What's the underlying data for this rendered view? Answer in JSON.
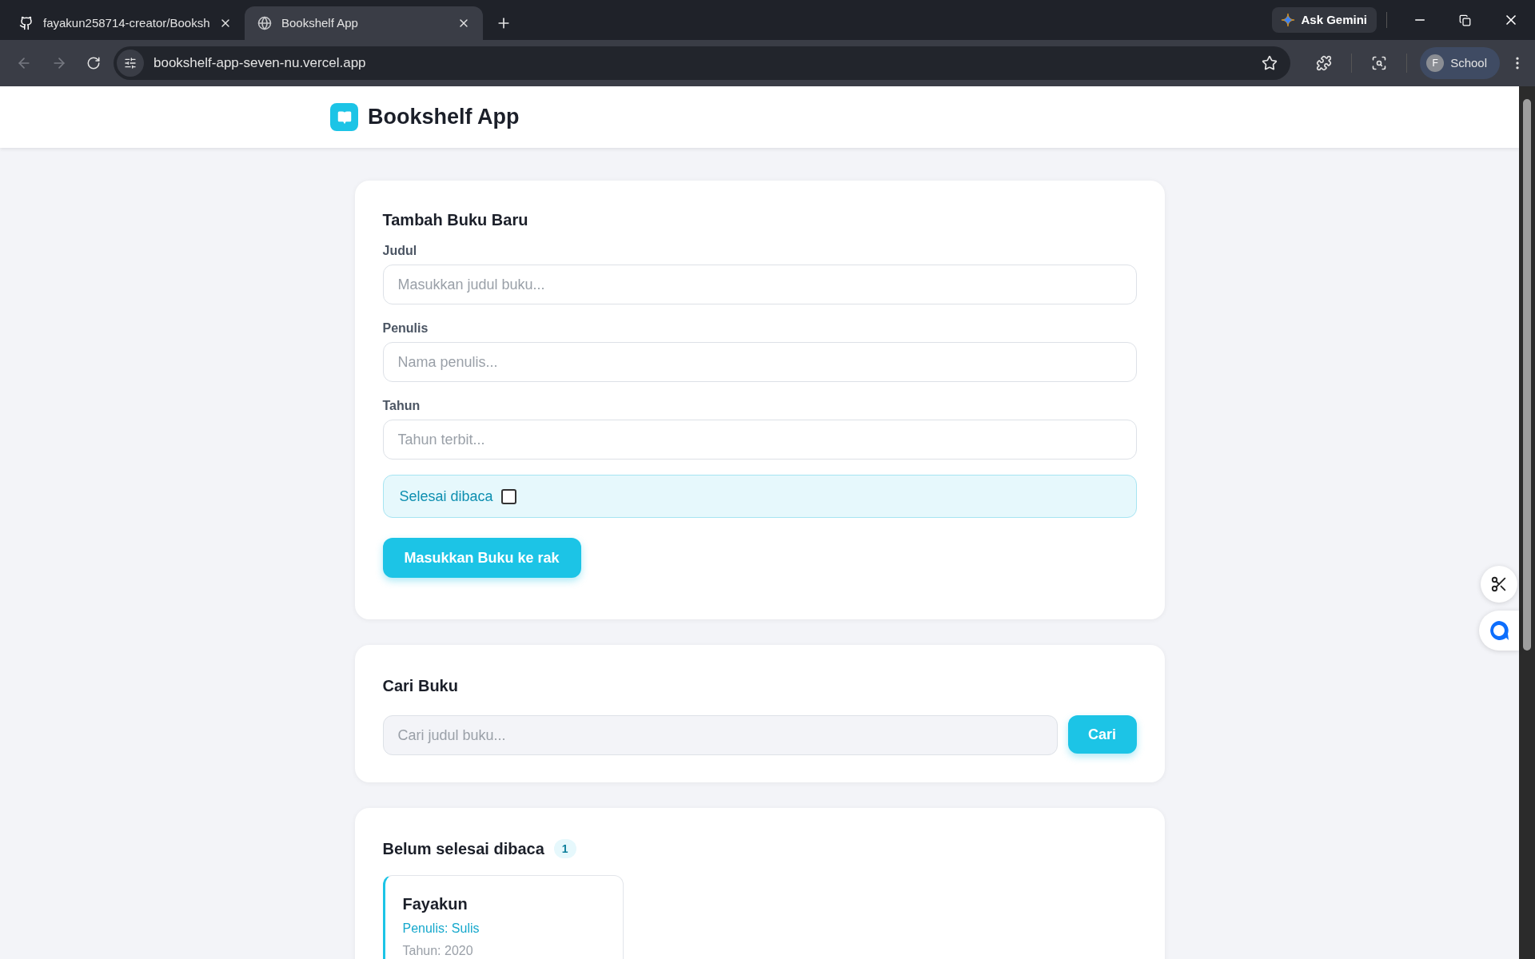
{
  "browser": {
    "tabs": [
      {
        "kind": "github",
        "title": "fayakun258714-creator/Booksh",
        "selected": false
      },
      {
        "kind": "globe",
        "title": "Bookshelf App",
        "selected": true
      }
    ],
    "address": "bookshelf-app-seven-nu.vercel.app",
    "gemini": "Ask Gemini",
    "profile": {
      "initial": "F",
      "name": "School"
    }
  },
  "app": {
    "title": "Bookshelf App"
  },
  "form": {
    "title": "Tambah Buku Baru",
    "fields": [
      {
        "label": "Judul",
        "placeholder": "Masukkan judul buku..."
      },
      {
        "label": "Penulis",
        "placeholder": "Nama penulis..."
      },
      {
        "label": "Tahun",
        "placeholder": "Tahun terbit..."
      }
    ],
    "checkbox": {
      "label": "Selesai dibaca",
      "checked": false
    },
    "submit": "Masukkan Buku ke rak"
  },
  "search": {
    "title": "Cari Buku",
    "placeholder": "Cari judul buku...",
    "button": "Cari"
  },
  "shelves": [
    {
      "title": "Belum selesai dibaca",
      "count": "1",
      "books": [
        {
          "title": "Fayakun",
          "author": "Penulis: Sulis",
          "year": "Tahun: 2020"
        }
      ]
    }
  ]
}
